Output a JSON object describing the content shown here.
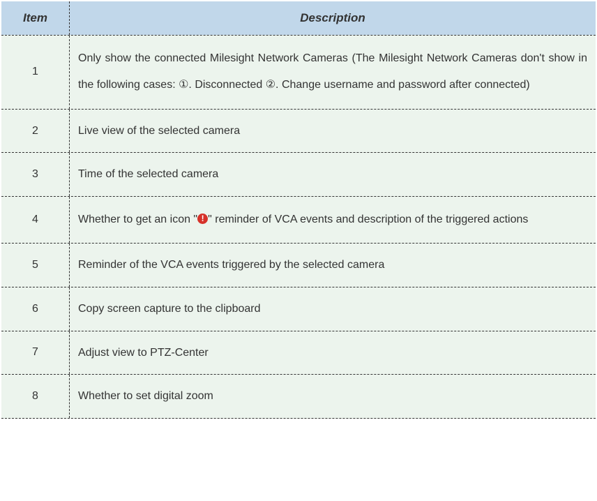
{
  "headers": {
    "item": "Item",
    "description": "Description"
  },
  "rows": [
    {
      "item": "1",
      "description_before": "Only show the connected Milesight Network Cameras (The Milesight Network Cameras don't show in the following cases: ",
      "circled_1": "①",
      "mid_1": ". Disconnected ",
      "circled_2": "②",
      "description_after": ". Change username and password after connected)",
      "multiline": true,
      "has_circled": true
    },
    {
      "item": "2",
      "description": "Live view of the selected camera",
      "multiline": false
    },
    {
      "item": "3",
      "description": "Time of the selected camera",
      "multiline": false
    },
    {
      "item": "4",
      "description_before": "Whether to get an icon \"",
      "icon_char": "!",
      "description_after": "\" reminder of VCA events and description of the triggered actions",
      "multiline": true,
      "has_icon": true
    },
    {
      "item": "5",
      "description": "Reminder of the VCA events triggered by the selected camera",
      "multiline": false
    },
    {
      "item": "6",
      "description": "Copy screen capture to the clipboard",
      "multiline": false
    },
    {
      "item": "7",
      "description": "Adjust view to PTZ-Center",
      "multiline": false
    },
    {
      "item": "8",
      "description": "Whether to set digital zoom",
      "multiline": false
    }
  ]
}
